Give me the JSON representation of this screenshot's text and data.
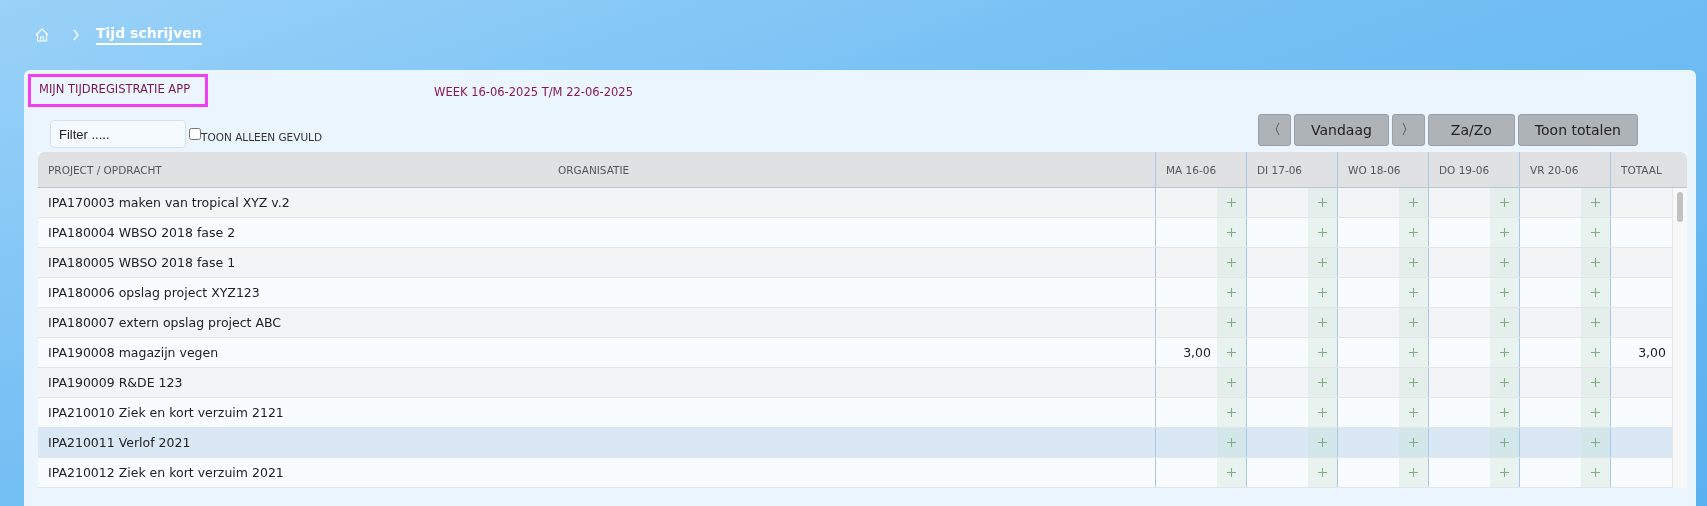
{
  "breadcrumb": {
    "current": "Tijd schrijven"
  },
  "title": "MIJN TIJDREGISTRATIE APP",
  "week": "WEEK 16-06-2025 T/M 22-06-2025",
  "filter": {
    "placeholder": "Filter .....",
    "show_only_filled": {
      "label": "TOON ALLEEN GEVULD",
      "checked": false
    }
  },
  "buttons": [
    {
      "kind": "prev",
      "label": "〈"
    },
    {
      "kind": "text",
      "label": "Vandaag"
    },
    {
      "kind": "next",
      "label": "〉"
    },
    {
      "kind": "text",
      "label": "Za/Zo"
    },
    {
      "kind": "text",
      "label": "Toon totalen"
    }
  ],
  "table": {
    "columns": [
      "PROJECT / OPDRACHT",
      "ORGANISATIE",
      "MA 16-06",
      "DI 17-06",
      "WO 18-06",
      "DO 19-06",
      "VR 20-06",
      "TOTAAL"
    ],
    "rows": [
      {
        "project": "IPA170003 maken van tropical XYZ v.2",
        "selected": false
      },
      {
        "project": "IPA180004 WBSO 2018 fase 2",
        "selected": false
      },
      {
        "project": "IPA180005 WBSO 2018 fase 1",
        "selected": false
      },
      {
        "project": "IPA180006 opslag project XYZ123",
        "selected": false
      },
      {
        "project": "IPA180007 extern opslag project ABC",
        "selected": false
      },
      {
        "project": "IPA190008 magazijn vegen",
        "ma": "3,00",
        "total": "3,00",
        "selected": false
      },
      {
        "project": "IPA190009 R&DE 123",
        "selected": false
      },
      {
        "project": "IPA210010 Ziek en kort verzuim 2121",
        "selected": false
      },
      {
        "project": "IPA210011 Verlof 2021",
        "selected": true
      },
      {
        "project": "IPA210012 Ziek en kort verzuim 2021",
        "selected": false
      }
    ]
  }
}
